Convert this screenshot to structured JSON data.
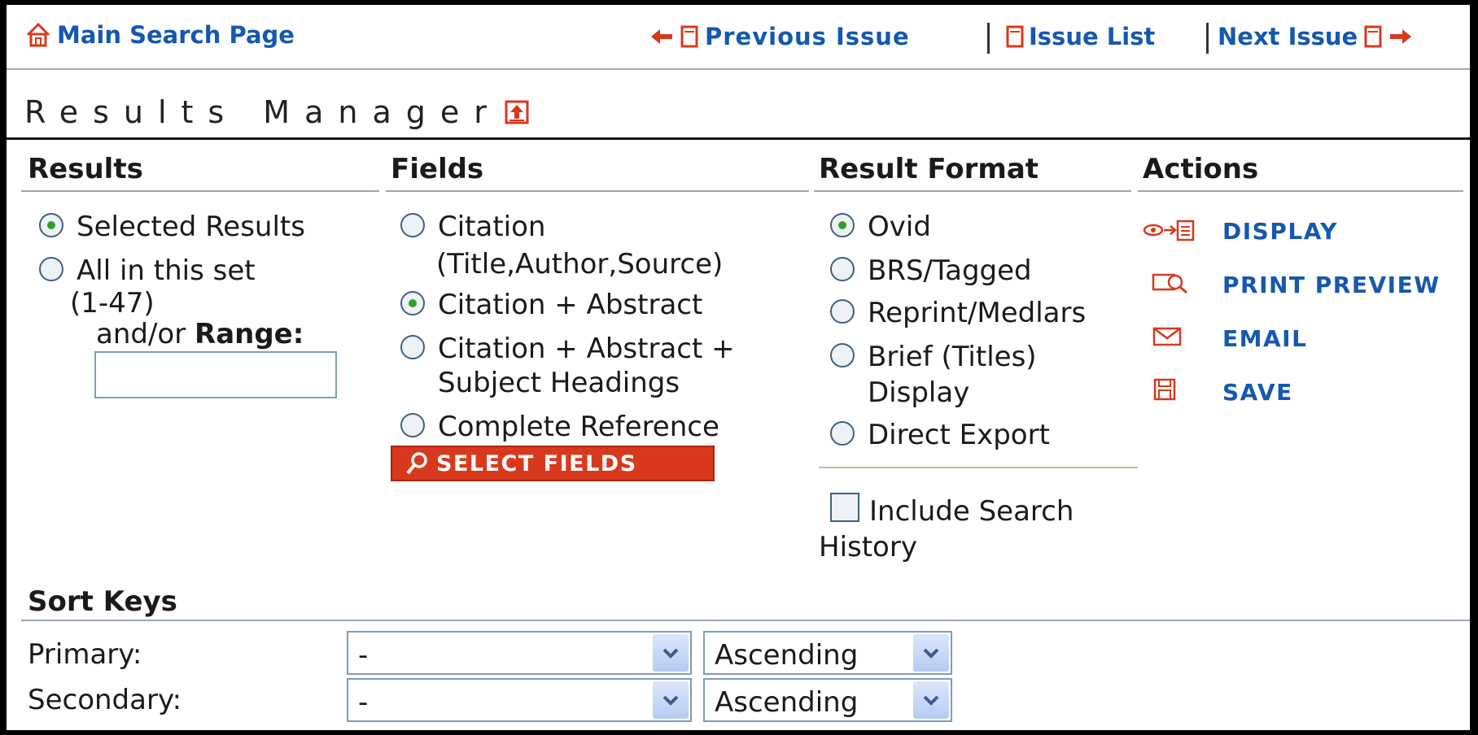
{
  "topnav": {
    "main_search": "Main Search Page",
    "previous_issue": "Previous Issue",
    "issue_list": "Issue List",
    "next_issue": "Next Issue"
  },
  "results_manager": {
    "title": "Results Manager"
  },
  "columns": {
    "results": "Results",
    "fields": "Fields",
    "result_format": "Result Format",
    "actions": "Actions"
  },
  "results": {
    "selected": "Selected Results",
    "all_in_set": "All in this set",
    "all_range": "(1-47)",
    "and_or": "and/or",
    "range_label": "Range:",
    "range_value": ""
  },
  "fields": {
    "citation_line1": "Citation",
    "citation_line2": "(Title,Author,Source)",
    "citation_abstract": "Citation + Abstract",
    "cas_line1": "Citation + Abstract +",
    "cas_line2": "Subject Headings",
    "complete": "Complete Reference",
    "select_fields_button": "SELECT FIELDS"
  },
  "format": {
    "ovid": "Ovid",
    "brs": "BRS/Tagged",
    "reprint": "Reprint/Medlars",
    "brief_line1": "Brief (Titles)",
    "brief_line2": "Display",
    "direct_export": "Direct Export",
    "include_line1": "Include Search",
    "include_line2": "History"
  },
  "actions": {
    "display": "DISPLAY",
    "print_preview": "PRINT PREVIEW",
    "email": "EMAIL",
    "save": "SAVE"
  },
  "sort": {
    "title": "Sort Keys",
    "primary_label": "Primary:",
    "secondary_label": "Secondary:",
    "primary_value": "-",
    "primary_order": "Ascending",
    "secondary_value": "-",
    "secondary_order": "Ascending"
  },
  "colors": {
    "link": "#1558b0",
    "accent": "#d8391c",
    "button_bg": "#d8391c"
  }
}
